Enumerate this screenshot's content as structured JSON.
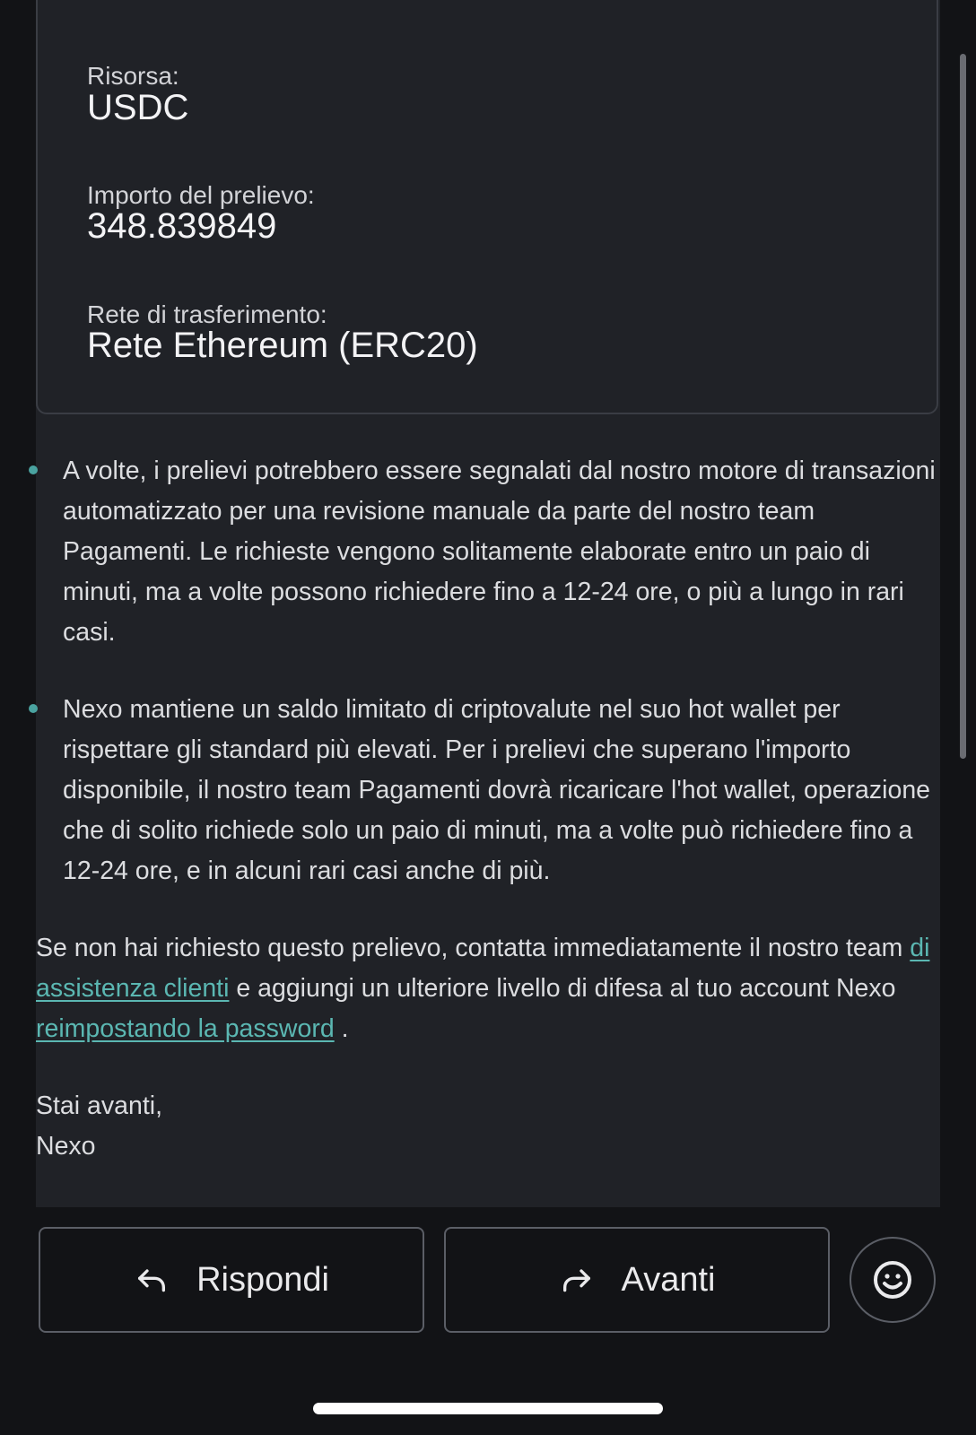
{
  "details": {
    "asset_label": "Risorsa:",
    "asset_value": "USDC",
    "amount_label": "Importo del prelievo:",
    "amount_value": "348.839849",
    "network_label": "Rete di trasferimento:",
    "network_value": "Rete Ethereum (ERC20)"
  },
  "bullets": [
    "A volte, i prelievi potrebbero essere segnalati dal nostro motore di transazioni automatizzato per una revisione manuale da parte del nostro team Pagamenti. Le richieste vengono solitamente elaborate entro un paio di minuti, ma a volte possono richiedere fino a 12-24 ore, o più a lungo in rari casi.",
    "Nexo mantiene un saldo limitato di criptovalute nel suo hot wallet per rispettare gli standard più elevati. Per i prelievi che superano l'importo disponibile, il nostro team Pagamenti dovrà ricaricare l'hot wallet, operazione che di solito richiede solo un paio di minuti, ma a volte può richiedere fino a 12-24 ore, e in alcuni rari casi anche di più."
  ],
  "warning": {
    "text_1": "Se non hai richiesto questo prelievo, contatta immediatamente il nostro team",
    "link_1": "di assistenza clienti",
    "text_2": "e aggiungi un ulteriore livello di difesa al tuo account Nexo",
    "link_2": "reimpostando la password",
    "text_3": "."
  },
  "signoff": {
    "greeting": "Stai avanti,",
    "sender": "Nexo"
  },
  "actions": {
    "reply_label": "Rispondi",
    "forward_label": "Avanti",
    "reply_icon": "reply-arrow-icon",
    "forward_icon": "forward-arrow-icon",
    "emoji_icon": "smiley-icon"
  },
  "colors": {
    "background": "#121316",
    "card": "#202227",
    "accent_link": "#5bb7b2",
    "bullet_dot": "#4aa3a0"
  }
}
